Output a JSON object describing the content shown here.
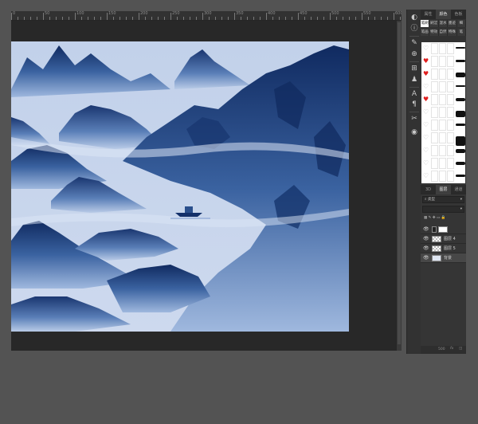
{
  "ruler": {
    "numbers": [
      "0",
      "50",
      "100",
      "150",
      "200",
      "250",
      "300",
      "350",
      "400",
      "450",
      "500",
      "550",
      "600"
    ]
  },
  "canvas": {
    "artwork": "ink landscape painting",
    "colors": {
      "sky": "#c4d3eb",
      "ink_dark": "#102a60",
      "ink_mid": "#2e5896",
      "ink_light": "#8eabd7",
      "mist": "#dce6f5"
    }
  },
  "tools": [
    {
      "icon": "adjustment-icon",
      "glyph": "◐"
    },
    {
      "icon": "info-icon",
      "glyph": "ⓘ"
    },
    {
      "icon": "brush-tool-icon",
      "glyph": "✎"
    },
    {
      "icon": "clone-stamp-icon",
      "glyph": "⊕"
    },
    {
      "icon": "history-icon",
      "glyph": "⊞"
    },
    {
      "icon": "people-icon",
      "glyph": "♟"
    },
    {
      "icon": "character-icon",
      "glyph": "A"
    },
    {
      "icon": "paragraph-icon",
      "glyph": "¶"
    },
    {
      "icon": "transform-icon",
      "glyph": "✂"
    },
    {
      "icon": "timeline-icon",
      "glyph": "◉"
    }
  ],
  "top_tabs": [
    "属性",
    "颜色",
    "色板"
  ],
  "brush_tabs_row1": [
    "笔刷",
    "刷涩",
    "湿水",
    "墨迹",
    "细"
  ],
  "brush_tabs_row2": [
    "笔画",
    "特效",
    "自然",
    "特殊",
    "笔"
  ],
  "brush_favorites": [
    false,
    true,
    true,
    false,
    true,
    false,
    false,
    false,
    false,
    false,
    false
  ],
  "layers_tabs": [
    "3D",
    "图层",
    "通道"
  ],
  "layers_filter": {
    "kind_label": "类型"
  },
  "layers": [
    {
      "name": "",
      "visible": true,
      "type": "adjustment"
    },
    {
      "name": "图层 4",
      "visible": true,
      "type": "transparent"
    },
    {
      "name": "图层 5",
      "visible": true,
      "type": "transparent"
    },
    {
      "name": "背景",
      "visible": true,
      "type": "background"
    }
  ],
  "footer": {
    "zoom": "500"
  }
}
